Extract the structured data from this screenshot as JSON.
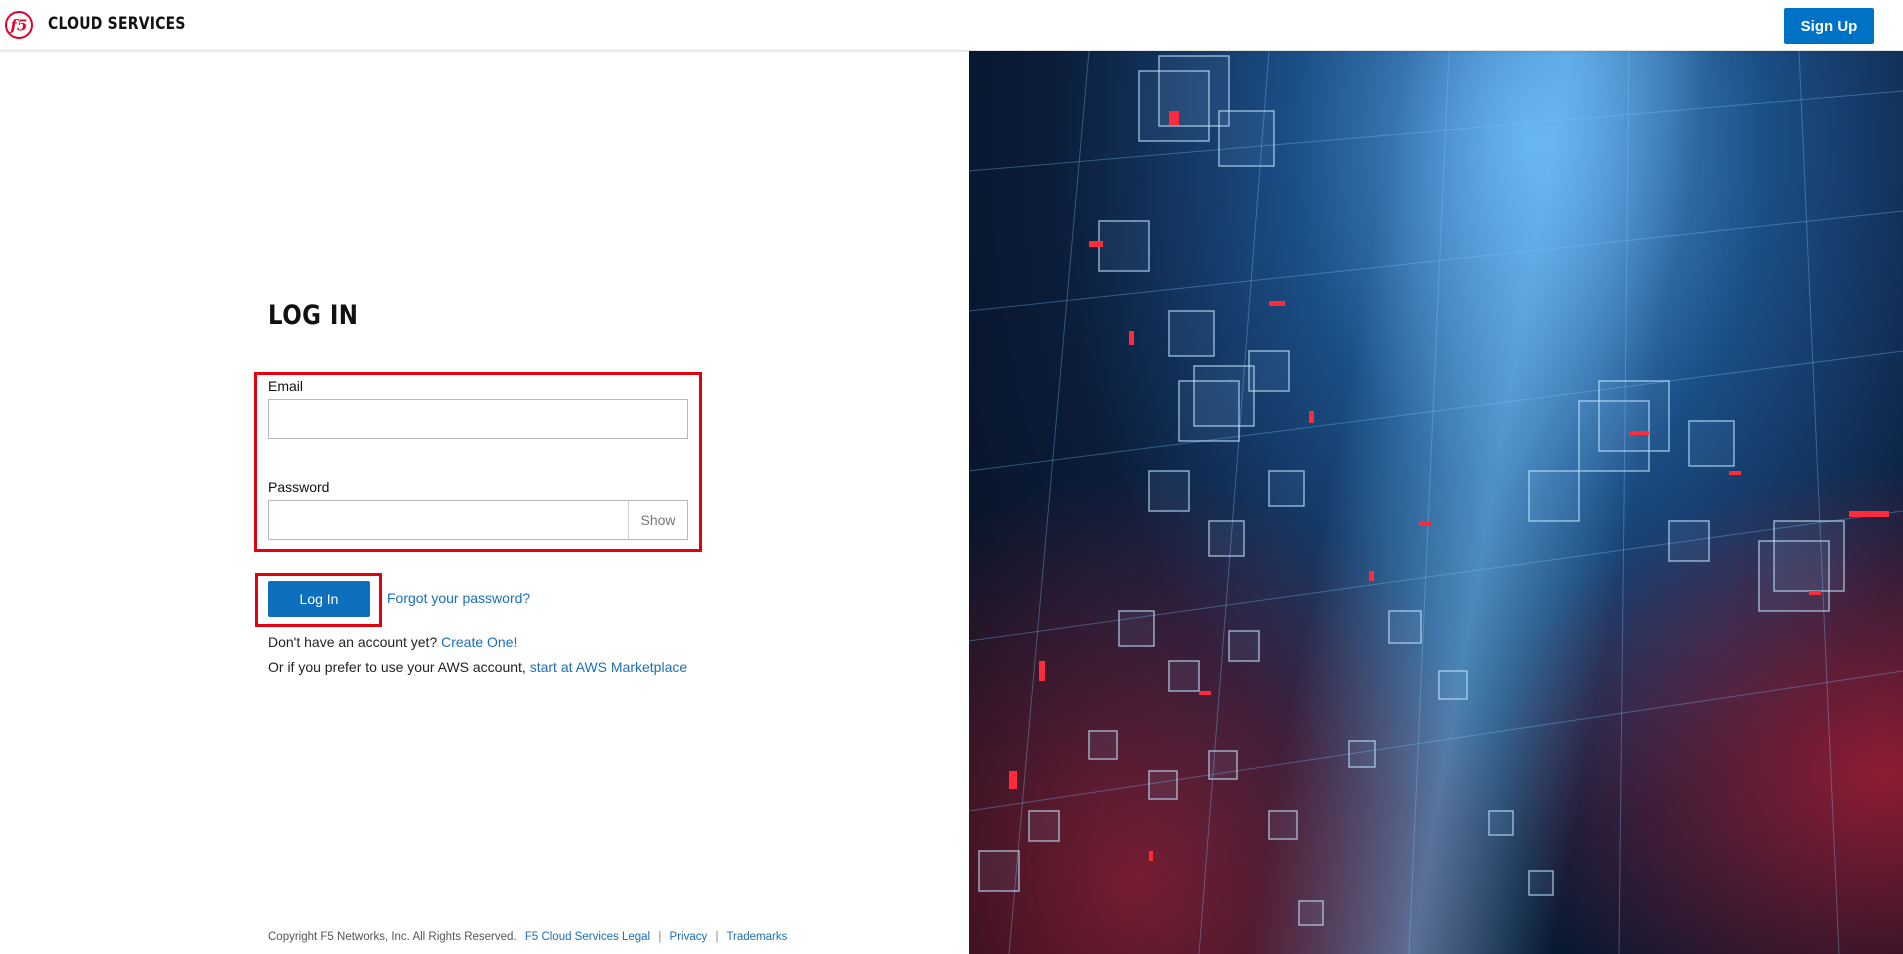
{
  "header": {
    "logo_text": "f5",
    "brand": "CLOUD SERVICES",
    "signup_label": "Sign Up"
  },
  "login": {
    "title": "LOG IN",
    "email_label": "Email",
    "email_value": "",
    "password_label": "Password",
    "password_value": "",
    "show_label": "Show",
    "submit_label": "Log In",
    "forgot_label": "Forgot your password?",
    "no_account_text": "Don't have an account yet?",
    "create_label": "Create One!",
    "aws_text": "Or if you prefer to use your AWS account,",
    "aws_link": "start at AWS Marketplace"
  },
  "footer": {
    "copyright": "Copyright F5 Networks, Inc. All Rights Reserved.",
    "legal": "F5 Cloud Services Legal",
    "privacy": "Privacy",
    "trademarks": "Trademarks",
    "separator": "|"
  },
  "colors": {
    "accent": "#0072c6",
    "highlight": "#e3000f",
    "logo_red": "#e4002b"
  },
  "icons": {
    "logo": "f5-logo-icon"
  }
}
